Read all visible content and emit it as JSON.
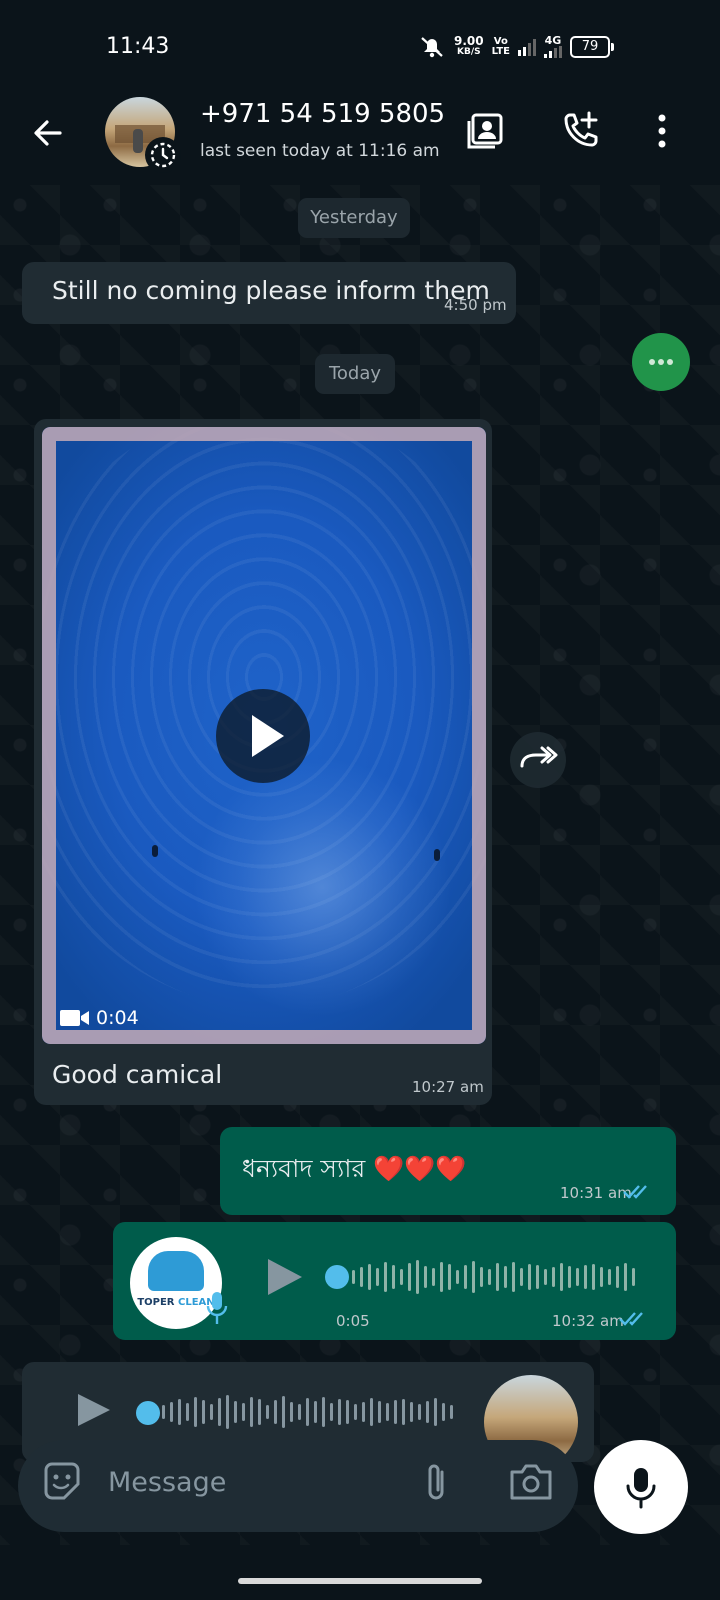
{
  "status_bar": {
    "time": "11:43",
    "net_speed_value": "9.00",
    "net_speed_unit": "KB/S",
    "volte_top": "Vo",
    "volte_bottom": "LTE",
    "network": "4G",
    "battery": "79"
  },
  "header": {
    "contact_name": "+971 54 519 5805",
    "last_seen": "last seen today at 11:16 am"
  },
  "messages": {
    "date_yesterday": "Yesterday",
    "msg1_text": "Still no coming please inform them",
    "msg1_time": "4:50 pm",
    "date_today": "Today",
    "video_duration": "0:04",
    "video_caption": "Good camical",
    "video_time": "10:27 am",
    "msg3_text": "ধন্যবাদ স্যার ❤️❤️❤️",
    "msg3_time": "10:31 am",
    "voice_duration": "0:05",
    "voice_time": "10:32 am",
    "voice_avatar_text_1": "TOPER",
    "voice_avatar_text_2": "CLEAN"
  },
  "composer": {
    "placeholder": "Message"
  },
  "colors": {
    "background": "#0b141a",
    "incoming_bubble": "#202c33",
    "outgoing_bubble": "#005c4b",
    "read_tick": "#53bdeb",
    "fab": "#21944a"
  }
}
